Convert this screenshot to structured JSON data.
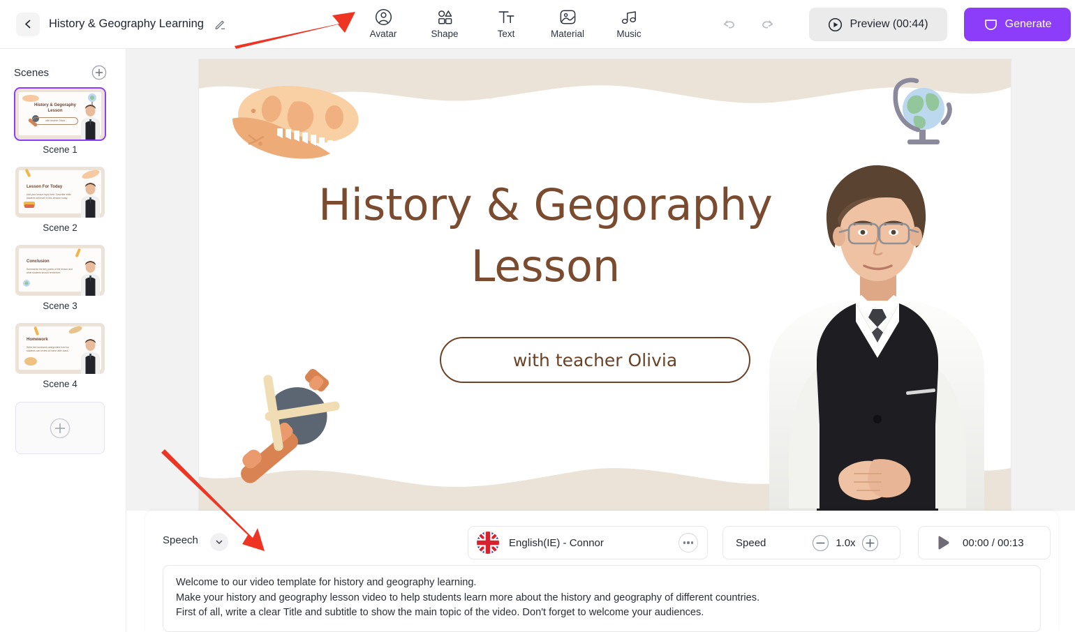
{
  "header": {
    "back_icon": "chevron-left-icon",
    "project_title": "History & Geography Learning",
    "edit_icon": "pencil-icon",
    "tools": [
      {
        "label": "Avatar",
        "icon": "avatar-icon"
      },
      {
        "label": "Shape",
        "icon": "shape-icon"
      },
      {
        "label": "Text",
        "icon": "text-icon"
      },
      {
        "label": "Material",
        "icon": "material-image-icon"
      },
      {
        "label": "Music",
        "icon": "music-note-icon"
      }
    ],
    "undo_icon": "undo-icon",
    "redo_icon": "redo-icon",
    "preview_label": "Preview (00:44)",
    "preview_icon": "play-circle-icon",
    "generate_label": "Generate",
    "generate_icon": "generate-icon",
    "generate_color": "#8b3dfa"
  },
  "sidebar": {
    "title": "Scenes",
    "add_icon": "plus-circle-icon",
    "add_scene_icon": "plus-circle-icon",
    "scenes": [
      {
        "label": "Scene 1",
        "selected": true,
        "mini_title": "History & Gegoraphy Lesson",
        "mini_body": "with teacher Olivia"
      },
      {
        "label": "Scene 2",
        "selected": false,
        "mini_title": "Lesson For Today",
        "mini_body": "Add your lesson topic here. Describe what students will learn in this session today."
      },
      {
        "label": "Scene 3",
        "selected": false,
        "mini_title": "Conclusion",
        "mini_body": "Summarize the key points of the lesson and what students should remember."
      },
      {
        "label": "Scene 4",
        "selected": false,
        "mini_title": "Homework",
        "mini_body": "Write the homework assignment here so students can review at home after class."
      }
    ]
  },
  "canvas": {
    "slide_title_line1": "History & Gegoraphy",
    "slide_title_line2": "Lesson",
    "subtitle": "with teacher Olivia",
    "title_color": "#7a4b2e",
    "background_color": "#ece3d8",
    "paper_color": "#ffffff",
    "decorations": [
      {
        "name": "dinosaur-skull-illustration"
      },
      {
        "name": "globe-illustration"
      },
      {
        "name": "stone-hammer-illustration"
      }
    ],
    "avatar_name": "presenter-avatar"
  },
  "speech": {
    "label": "Speech",
    "collapse_icon": "chevron-down-icon",
    "voice": {
      "flag_icon": "uk-flag-icon",
      "name": "English(IE) - Connor",
      "more_icon": "more-options-icon"
    },
    "speed": {
      "label": "Speed",
      "minus_icon": "minus-circle-icon",
      "value": "1.0x",
      "plus_icon": "plus-circle-icon"
    },
    "player": {
      "play_icon": "play-icon",
      "time": "00:00 / 00:13"
    },
    "script_lines": [
      "Welcome to our video template for history and geography learning.",
      "Make your history and geography lesson video to help students learn more about the history and geography of different countries.",
      "First of all, write a clear Title and subtitle to show the main topic of the video. Don't forget to welcome your audiences."
    ]
  },
  "annotations": {
    "arrow_color": "#ee3524",
    "arrows": [
      {
        "name": "arrow-to-toolbar"
      },
      {
        "name": "arrow-to-speech"
      }
    ]
  }
}
